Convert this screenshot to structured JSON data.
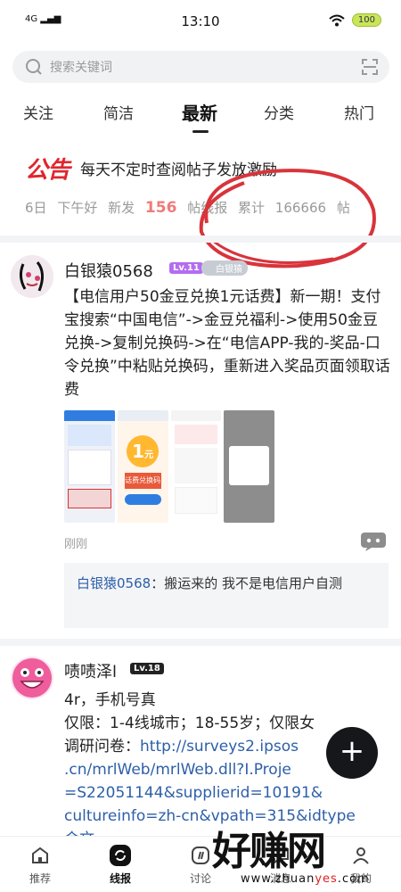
{
  "status_bar": {
    "network": "4G",
    "time": "13:10",
    "battery": "100"
  },
  "search": {
    "placeholder": "搜索关键词"
  },
  "tabs": [
    {
      "label": "关注"
    },
    {
      "label": "简洁"
    },
    {
      "label": "最新",
      "active": true
    },
    {
      "label": "分类"
    },
    {
      "label": "热门"
    }
  ],
  "notice": {
    "badge": "公告",
    "text": "每天不定时查阅帖子发放激励",
    "stats": {
      "day": "6日",
      "greeting": "下午好",
      "new_label": "新发",
      "new_count": "156",
      "unit1": "帖线报",
      "total_label": "累计",
      "total_count": "166666",
      "unit2": "帖"
    }
  },
  "posts": [
    {
      "username": "白银猿0568",
      "level": "Lv.11",
      "badge": "白银猿",
      "content": "【电信用户50金豆兑换1元话费】新一期！支付宝搜索“中国电信”->金豆兑福利->使用50金豆兑换->复制兑换码->在“电信APP-我的-奖品-口令兑换”中粘贴兑换码，重新进入奖品页面领取话费",
      "image_texts": {
        "coin": "1",
        "coin_unit": "元",
        "coin_caption": "话费兑换码"
      },
      "time": "刚刚",
      "reply": {
        "name": "白银猿0568",
        "text": "搬运来的 我不是电信用户自测"
      }
    },
    {
      "username": "啧啧泽l",
      "level": "Lv.18",
      "content_line1": "4r，手机号真",
      "content_line2": "仅限：1-4线城市；18-55岁；仅限女",
      "content_prefix": "调研问卷：",
      "link": "http://surveys2.ipsos.cn/mrlWeb/mrlWeb.dll?I.Project=S22051144&supplierid=10191&cultureinfo=zh-cn&vpath=315&idtype",
      "link_visible_1": "http://surveys2.ipsos",
      "link_visible_2": ".cn/mrlWeb/mrlWeb.dll?I.Proje",
      "link_visible_3": "=S22051144&supplierid=10191&",
      "link_visible_4": "cultureinfo=zh-cn&vpath=315&idtype",
      "link_visible_5": "会文"
    }
  ],
  "fab": {
    "label": "+"
  },
  "bottom_nav": [
    {
      "label": "推荐",
      "icon": "home-icon"
    },
    {
      "label": "线报",
      "icon": "refresh-icon",
      "active": true
    },
    {
      "label": "讨论",
      "icon": "discuss-icon"
    },
    {
      "label": "消息",
      "icon": "message-icon"
    },
    {
      "label": "我的",
      "icon": "profile-icon"
    }
  ],
  "watermark": {
    "big": "好赚网",
    "small_prefix": "www.zhuan",
    "small_red": "yes",
    "small_suffix": ".com"
  },
  "colors": {
    "accent_red": "#e0262e",
    "link_blue": "#2d5fa8",
    "stat_red": "#f07a7a",
    "level_purple": "#b36df0"
  }
}
